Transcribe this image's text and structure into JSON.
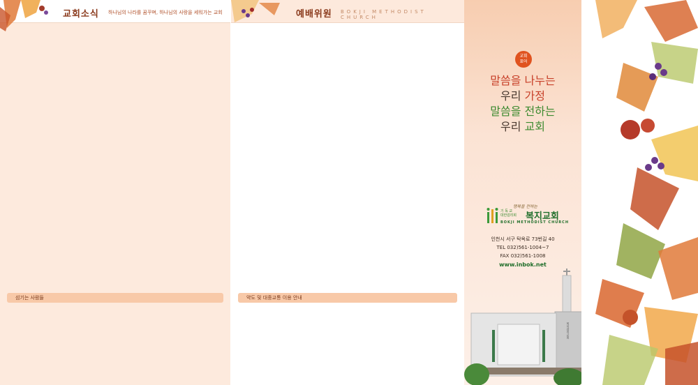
{
  "panel1": {
    "title": "교회소식",
    "subtitle": "하나님의 나라를 꿈꾸며, 하나님의 사랑을 세워가는 교회",
    "section_label": "섬기는 사람들"
  },
  "panel2": {
    "title": "예배위원",
    "subtitle": "BOKJI METHODIST CHURCH",
    "section_label": "약도 및 대중교통 이용 안내"
  },
  "cover": {
    "badge": [
      "교회",
      "표어"
    ],
    "slogan": [
      {
        "a": "말씀을 ",
        "b": "나누는"
      },
      {
        "a": "우리 ",
        "b": "가정"
      },
      {
        "a": "말씀을 ",
        "b": "전하는"
      },
      {
        "a": "우리 ",
        "b": "교회"
      }
    ],
    "logo_tag": "행복을 전하는",
    "logo_small_1": "기 독 교",
    "logo_small_2": "대한감리회",
    "logo_name": "복지교회",
    "logo_en": "BOKJI METHODIST CHURCH",
    "address": "인천시 서구 탁옥로 73번길 40",
    "tel": "TEL 032)561-1004~7",
    "fax": "FAX 032)561-1008",
    "website": "www.inbok.net",
    "building_sign": "복지감리교회"
  },
  "colors": {
    "accent_red": "#e0531f",
    "brand_green": "#1f6e2a",
    "panel_peach": "#fdeadd"
  }
}
